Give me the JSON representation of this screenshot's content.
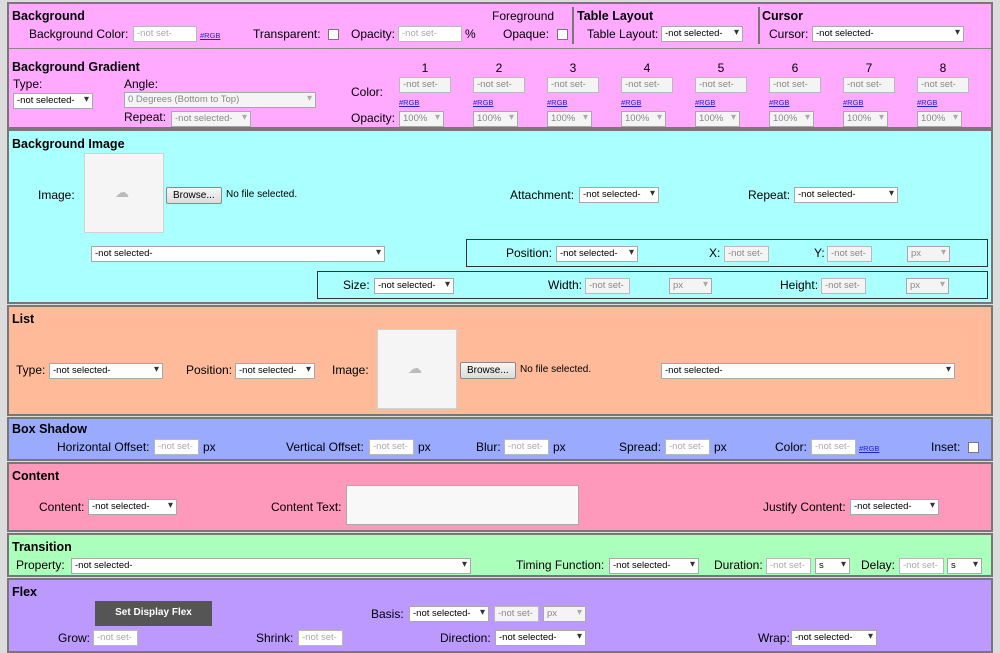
{
  "colors": {
    "background": "#ffaaff",
    "background_image": "#aaffff",
    "list": "#ffbb99",
    "box_shadow": "#99aaff",
    "content": "#ff99bb",
    "transition": "#aaffbb",
    "flex": "#bb99ff"
  },
  "common": {
    "not_set": "-not set-",
    "not_selected": "-not selected-",
    "rgb": "#RGB",
    "browse": "Browse...",
    "no_file": "No file selected.",
    "px": "px",
    "pct": "%",
    "s": "s"
  },
  "background": {
    "title": "Background",
    "bg_color_label": "Background Color:",
    "transparent_label": "Transparent:",
    "opacity_label": "Opacity:",
    "foreground_label": "Foreground",
    "opaque_label": "Opaque:",
    "table_title": "Table Layout",
    "table_label": "Table Layout:",
    "cursor_title": "Cursor",
    "cursor_label": "Cursor:"
  },
  "gradient": {
    "title": "Background Gradient",
    "type_label": "Type:",
    "angle_label": "Angle:",
    "angle_value": "0 Degrees (Bottom to Top)",
    "repeat_label": "Repeat:",
    "color_label": "Color:",
    "opacity_label": "Opacity:",
    "stops": [
      {
        "num": "1",
        "opacity": "100%"
      },
      {
        "num": "2",
        "opacity": "100%"
      },
      {
        "num": "3",
        "opacity": "100%"
      },
      {
        "num": "4",
        "opacity": "100%"
      },
      {
        "num": "5",
        "opacity": "100%"
      },
      {
        "num": "6",
        "opacity": "100%"
      },
      {
        "num": "7",
        "opacity": "100%"
      },
      {
        "num": "8",
        "opacity": "100%"
      }
    ]
  },
  "bg_image": {
    "title": "Background Image",
    "image_label": "Image:",
    "attachment_label": "Attachment:",
    "repeat_label": "Repeat:",
    "position_label": "Position:",
    "x_label": "X:",
    "y_label": "Y:",
    "size_label": "Size:",
    "width_label": "Width:",
    "height_label": "Height:"
  },
  "list": {
    "title": "List",
    "type_label": "Type:",
    "position_label": "Position:",
    "image_label": "Image:"
  },
  "box_shadow": {
    "title": "Box Shadow",
    "h_offset_label": "Horizontal Offset:",
    "v_offset_label": "Vertical Offset:",
    "blur_label": "Blur:",
    "spread_label": "Spread:",
    "color_label": "Color:",
    "inset_label": "Inset:"
  },
  "content": {
    "title": "Content",
    "content_label": "Content:",
    "text_label": "Content Text:",
    "justify_label": "Justify Content:"
  },
  "transition": {
    "title": "Transition",
    "property_label": "Property:",
    "timing_label": "Timing Function:",
    "duration_label": "Duration:",
    "delay_label": "Delay:"
  },
  "flex": {
    "title": "Flex",
    "set_button": "Set Display Flex",
    "basis_label": "Basis:",
    "grow_label": "Grow:",
    "shrink_label": "Shrink:",
    "direction_label": "Direction:",
    "wrap_label": "Wrap:"
  }
}
